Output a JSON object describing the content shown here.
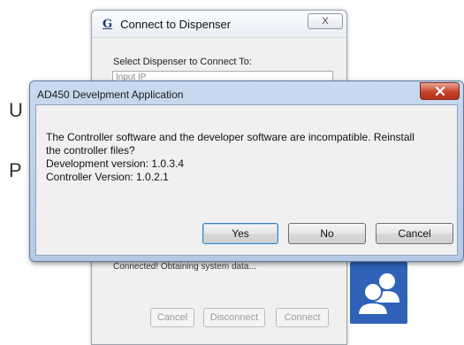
{
  "background": {
    "letter_1": "U",
    "letter_2": "P"
  },
  "back_window": {
    "title": "Connect to Dispenser",
    "logo_glyph": "G",
    "close_glyph": "X",
    "select_label": "Select Dispenser to Connect To:",
    "input_placeholder": "Input IP",
    "status_text": "Connected! Obtaining system data...",
    "buttons": {
      "cancel": "Cancel",
      "disconnect": "Disconnect",
      "connect": "Connect"
    }
  },
  "dialog": {
    "title": "AD450 Develpment Application",
    "message_line_1": "The Controller software and the developer software are incompatible. Reinstall",
    "message_line_2": "the controller files?",
    "message_line_3": "Development version: 1.0.3.4",
    "message_line_4": "Controller Version: 1.0.2.1",
    "buttons": {
      "yes": "Yes",
      "no": "No",
      "cancel": "Cancel"
    }
  },
  "colors": {
    "users_tile": "#2f62b8",
    "close_button": "#c7442b",
    "dialog_frame": "#b5c9e6"
  },
  "icons": {
    "users_tile_icon": "users-icon",
    "dialog_close_icon": "close-icon"
  }
}
